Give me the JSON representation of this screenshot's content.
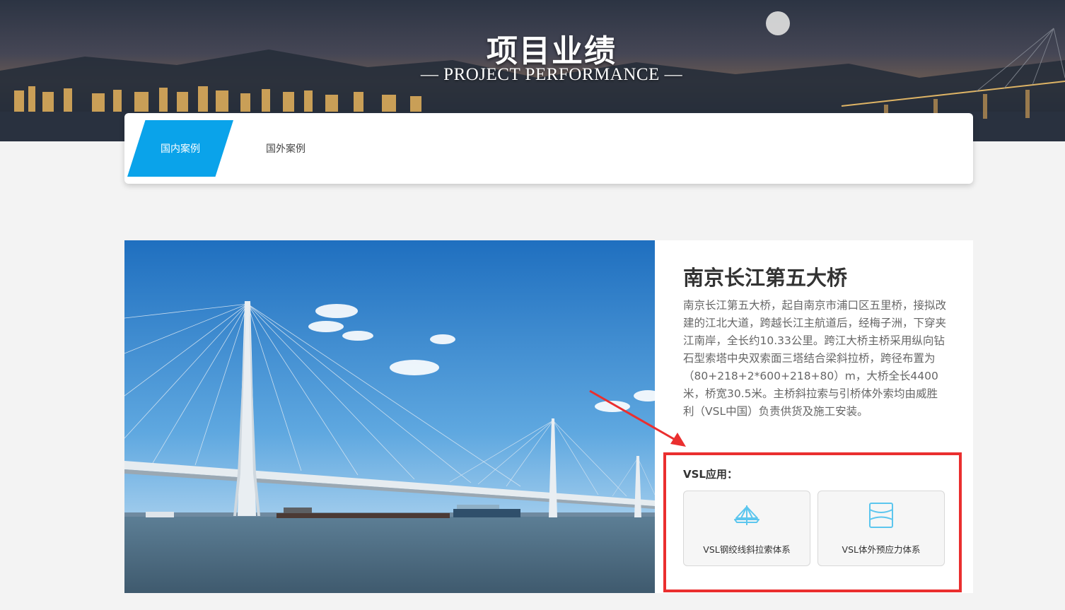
{
  "banner": {
    "title": "项目业绩",
    "subtitle": "— PROJECT PERFORMANCE —"
  },
  "tabs": [
    {
      "label": "国内案例",
      "active": true
    },
    {
      "label": "国外案例",
      "active": false
    }
  ],
  "project": {
    "title": "南京长江第五大桥",
    "description": "南京长江第五大桥，起自南京市浦口区五里桥，接拟改建的江北大道，跨越长江主航道后，经梅子洲，下穿夹江南岸，全长约10.33公里。跨江大桥主桥采用纵向钻石型索塔中央双索面三塔结合梁斜拉桥，跨径布置为（80+218+2*600+218+80）m，大桥全长4400米，桥宽30.5米。主桥斜拉索与引桥体外索均由威胜利（VSL中国）负责供货及施工安装。",
    "vsl_label": "VSL应用：",
    "applications": [
      {
        "label": "VSL钢绞线斜拉索体系",
        "icon": "cable-stayed-icon"
      },
      {
        "label": "VSL体外预应力体系",
        "icon": "external-prestress-icon"
      }
    ]
  },
  "colors": {
    "accent": "#0aa3ea",
    "highlight": "#ea2f2f",
    "icon": "#5cc6ee"
  }
}
